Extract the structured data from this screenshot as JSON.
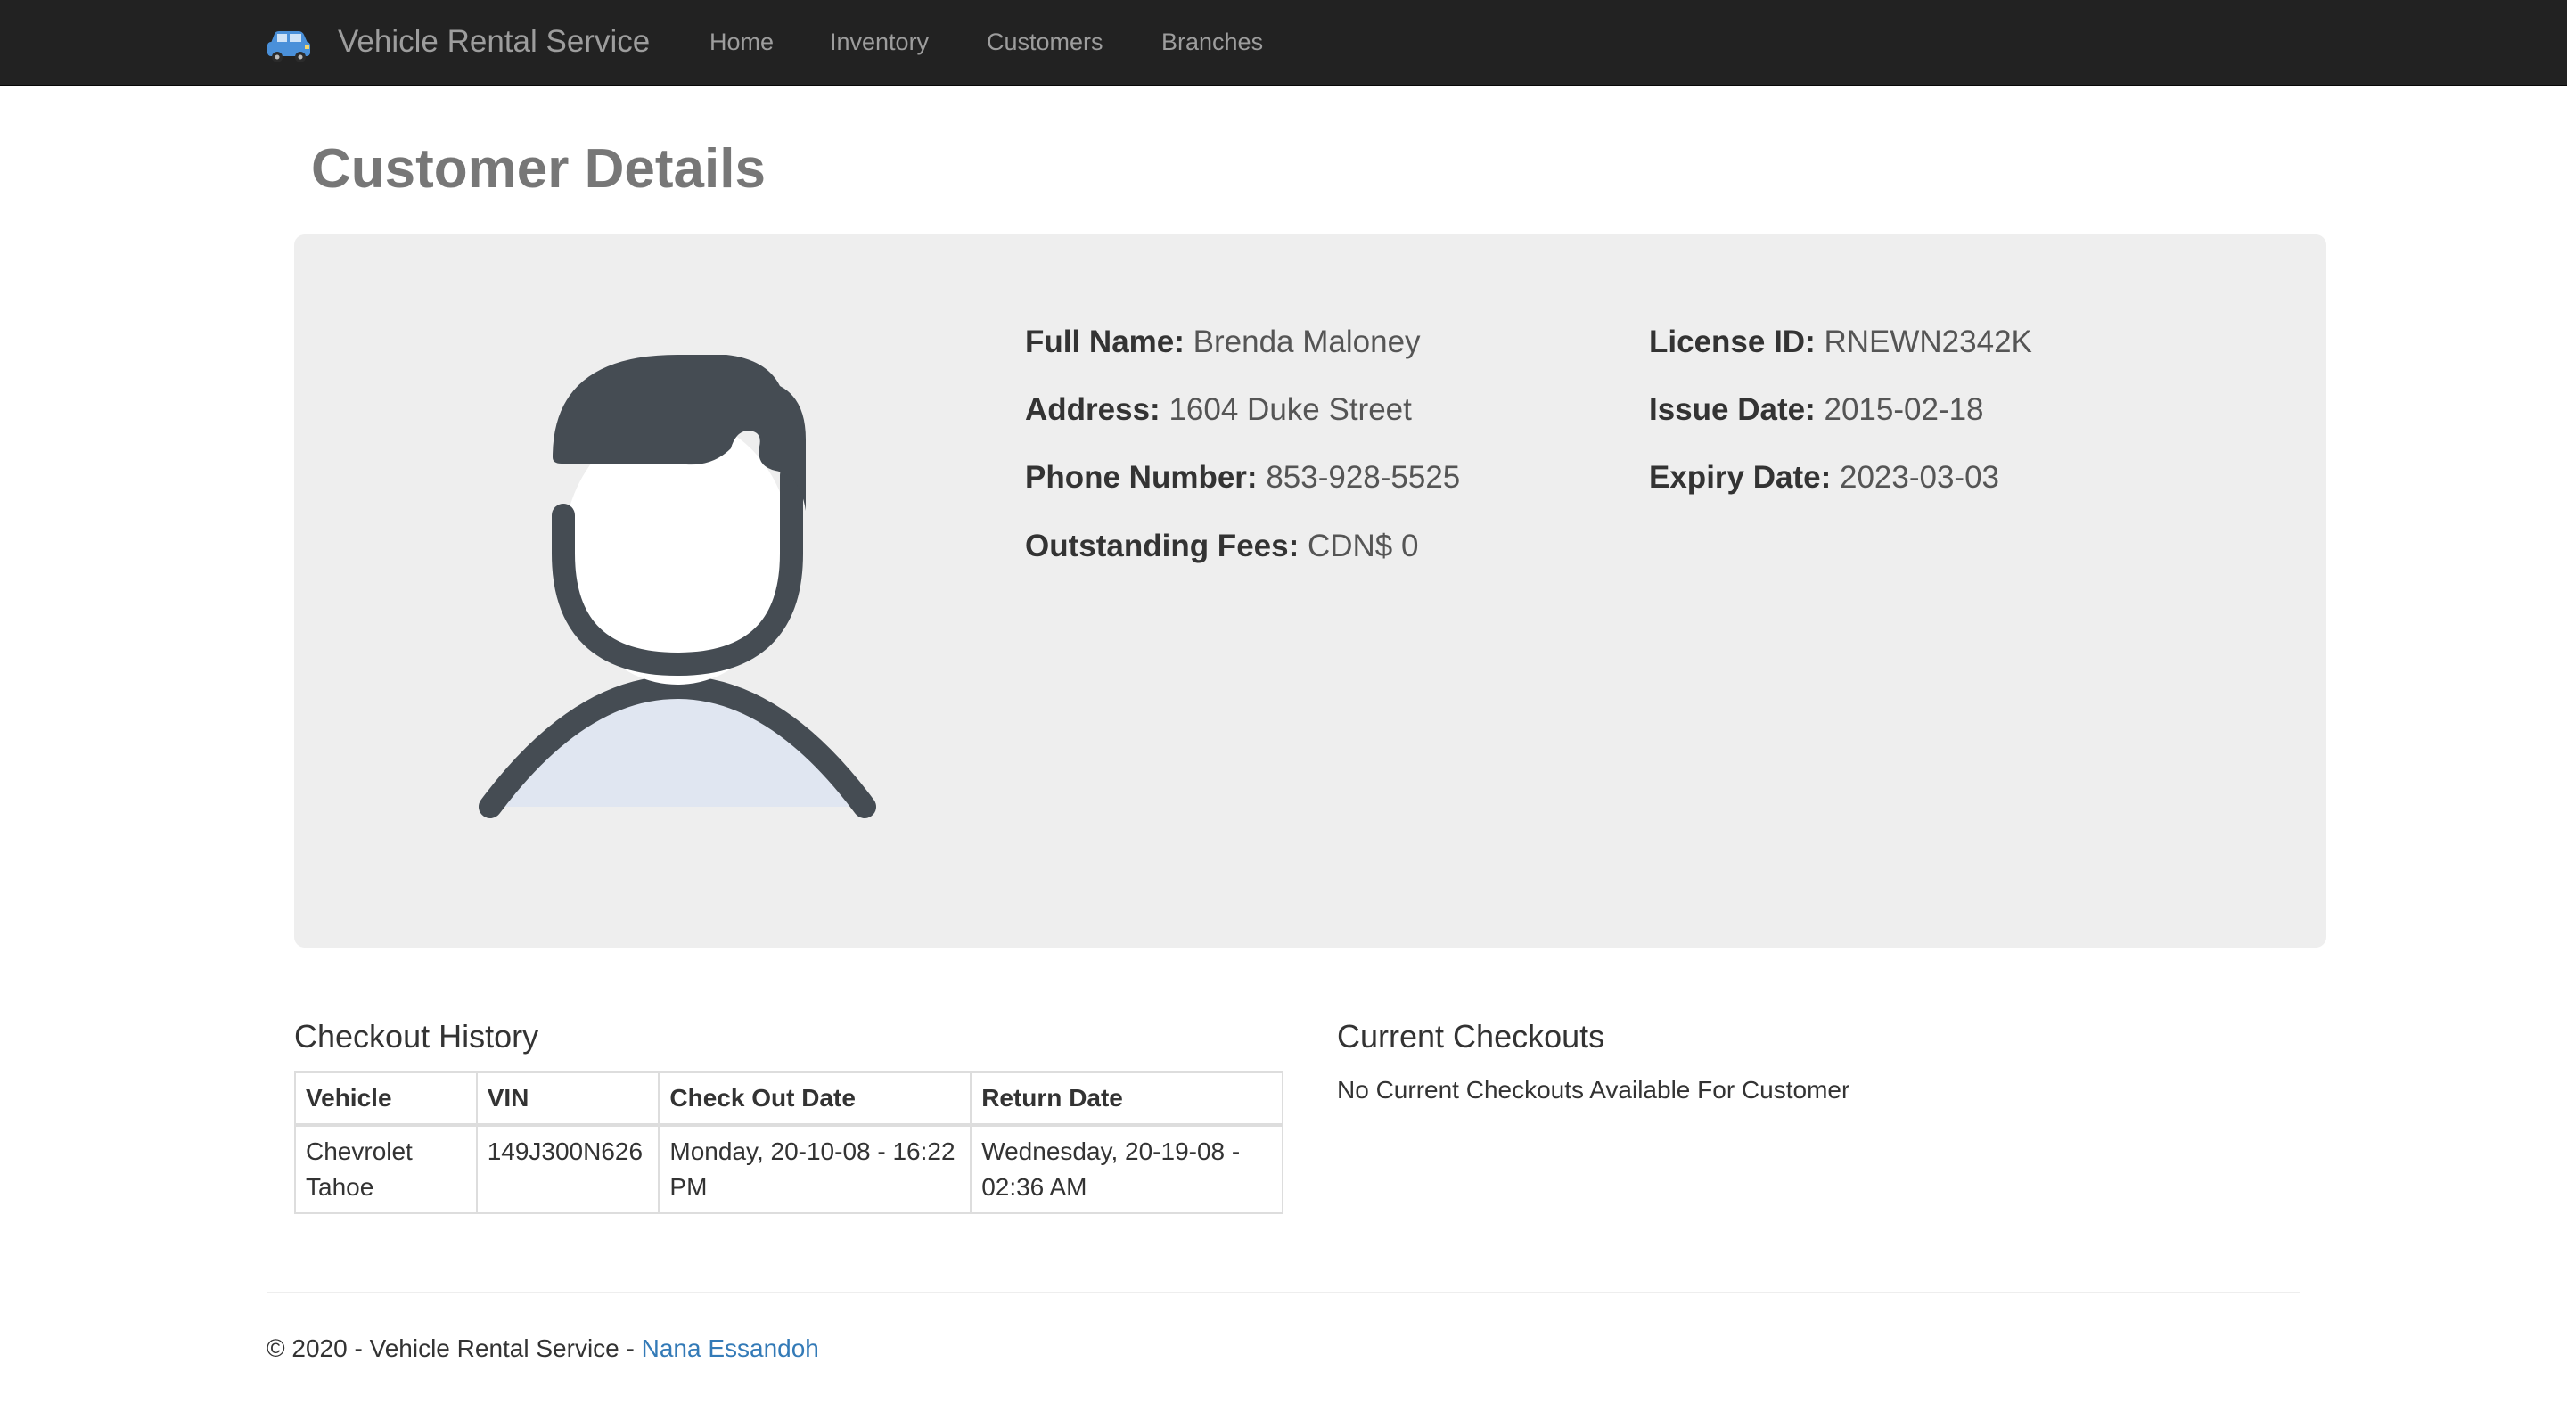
{
  "navbar": {
    "brand_icon": "car-icon",
    "brand": "Vehicle Rental Service",
    "links": {
      "home": "Home",
      "inventory": "Inventory",
      "customers": "Customers",
      "branches": "Branches"
    },
    "colors": {
      "background": "#222222",
      "link": "#9d9d9d"
    }
  },
  "page": {
    "title": "Customer Details"
  },
  "customer": {
    "avatar_icon": "user-avatar-icon",
    "full_name_label": "Full Name:",
    "full_name": "Brenda Maloney",
    "address_label": "Address:",
    "address": "1604 Duke Street",
    "phone_label": "Phone Number:",
    "phone": "853-928-5525",
    "fees_label": "Outstanding Fees:",
    "fees": "CDN$ 0",
    "license_label": "License ID:",
    "license": "RNEWN2342K",
    "issue_label": "Issue Date:",
    "issue_date": "2015-02-18",
    "expiry_label": "Expiry Date:",
    "expiry_date": "2023-03-03"
  },
  "checkout_history": {
    "title": "Checkout History",
    "columns": [
      "Vehicle",
      "VIN",
      "Check Out Date",
      "Return Date"
    ],
    "rows": [
      {
        "vehicle": "Chevrolet Tahoe",
        "vin": "149J300N626",
        "check_out": "Monday, 20-10-08 - 16:22 PM",
        "return": "Wednesday, 20-19-08 - 02:36 AM"
      }
    ]
  },
  "current_checkouts": {
    "title": "Current Checkouts",
    "empty_message": "No Current Checkouts Available For Customer"
  },
  "footer": {
    "text": "© 2020 - Vehicle Rental Service - ",
    "author_link": "Nana Essandoh",
    "link_color": "#337ab7"
  }
}
